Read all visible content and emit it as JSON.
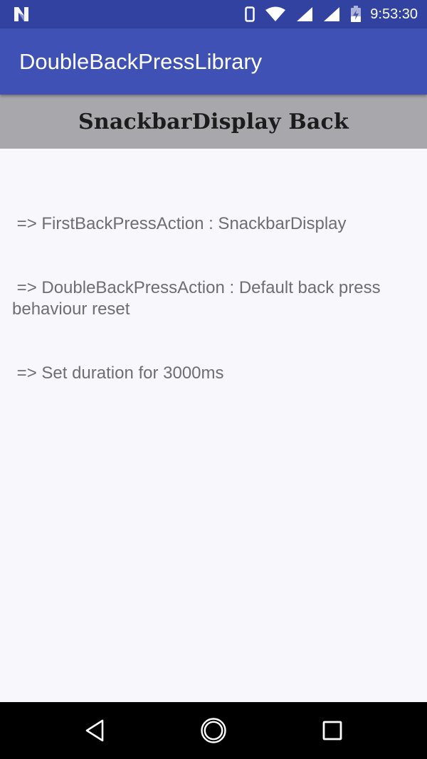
{
  "status_bar": {
    "time": "9:53:30",
    "icons": [
      "notification-n-icon",
      "phone-icon",
      "wifi-icon",
      "signal-icon",
      "signal-icon",
      "battery-charging-icon"
    ],
    "color": "#3142a0"
  },
  "app_bar": {
    "title": "DoubleBackPressLibrary",
    "color": "#3f51b5"
  },
  "header": {
    "title": "SnackbarDisplay Back",
    "background": "#a8a7ab"
  },
  "content": {
    "lines": [
      " => FirstBackPressAction : SnackbarDisplay",
      " => DoubleBackPressAction : Default back press behaviour reset",
      " => Set duration for 3000ms"
    ]
  },
  "nav_bar": {
    "buttons": [
      "back-icon",
      "home-icon",
      "recents-icon"
    ]
  }
}
